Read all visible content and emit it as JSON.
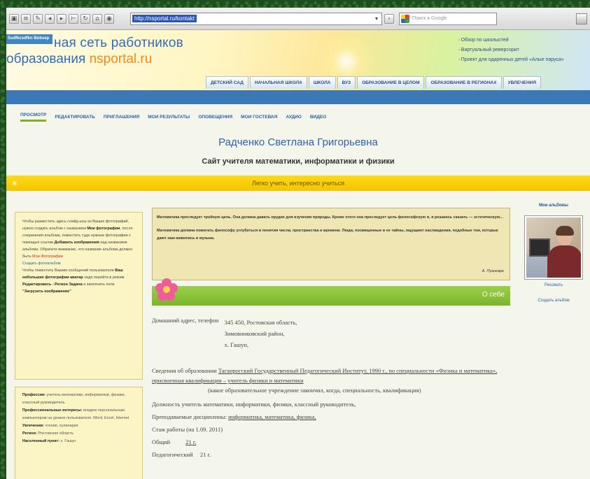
{
  "browser": {
    "url": "http://nsportal.ru/kontakt",
    "search_placeholder": "Поиск в Google"
  },
  "header": {
    "ribbon": "Ssdfkcsdfkn Bobsep",
    "site_name": "ная сеть работников",
    "site_sub_prefix": "образования ",
    "site_sub_brand": "nsportal.ru",
    "links": [
      "Обзор по школыстей",
      "Виртуальный реверсорит",
      "Проект для одаренных детей «Алые паруса»"
    ],
    "nav": [
      "ДЕТСКИЙ САД",
      "НАЧАЛЬНАЯ ШКОЛА",
      "ШКОЛА",
      "ВУЗ",
      "ОБРАЗОВАНИЕ В ЦЕЛОМ",
      "ОБРАЗОВАНИЕ В РЕГИОНАХ",
      "УВЛЕЧЕНИЯ"
    ]
  },
  "tabs": [
    "ПРОСМОТР",
    "РЕДАКТИРОВАТЬ",
    "ПРИГЛАШЕНИЯ",
    "МОИ РЕЗУЛЬТАТЫ",
    "ОПОВЕЩЕНИЯ",
    "МОИ ГОСТЕВАЯ",
    "АУДИО",
    "ВИДЕО"
  ],
  "page": {
    "title": "Радченко Светлана Григорьевна",
    "subtitle": "Сайт учителя математики, информатики и физики",
    "motto": "Легко учить, интересно учиться"
  },
  "left": {
    "box1": {
      "t1": "Чтобы разместить здесь слайд-шоу из Ваших фотографий, нужно создать альбом с названием",
      "b1": "Мои фотографии",
      "t2": ", после сохранения альбома, поместить туда нужные фотографии с помощью ссылки",
      "b2": "Добавить изображения",
      "t3": "над названием альбома. Обратите внимание, что название альбома должно быть",
      "r1": "Мои Фотографии",
      "l1": "Создать фотоальбом",
      "t4": "Чтобы поместить Вашим сообщений пользователи",
      "b3": "Ваш небольшие фотографии аватар",
      "t5": "надо перейти в режим",
      "b4": "Редактировать - Регион Задача",
      "t6": "и заполнить поле",
      "b5": "\"Загрузить изображение\""
    },
    "box2": {
      "rows": [
        {
          "k": "Профессия:",
          "v": "учитель математики, информатики, физики, классный руководитель"
        },
        {
          "k": "Профессиональные интересы:",
          "v": "владею персональным компьютером на уровне пользователя. Word, Excel, Internet"
        },
        {
          "k": "Увлечения:",
          "v": "чтение, кулинария"
        },
        {
          "k": "Регион:",
          "v": "Ростовская область"
        },
        {
          "k": "Населенный пункт:",
          "v": "х. Гашун"
        }
      ]
    }
  },
  "quote": {
    "p1": "Математика преследует тройную цель. Она должна давать орудие для изучения природы. Кроме этого она преследует цель философскую и, я решаюсь сказать — эстетическую...",
    "p2": "Математика должна помогать философу углубиться в понятия числа, пространства и времени. Люди, посвященные в ее тайны, ощущают наслаждения, подобные тем, которые дают нам живопись и музыка.",
    "author": "А. Пуанкаре"
  },
  "about_label": "О себе",
  "info": {
    "address_label": "Домашний адрес, телефон",
    "address_lines": [
      "345 450, Ростовская область,",
      "Зимовниковский район,",
      "х. Гашун,"
    ],
    "education_label": "Сведения об образовании",
    "education": "Таганрогский Государственный Педагогический Институт, 1990 г., по специальности «Физика и математика», присвоенная квалификация – учитель физики и математики",
    "education_note": "(какое образовательное учреждение закончил, когда, специальность, квалификация)",
    "position": "Должность    учитель математики, информатики, физики, классный руководитель,",
    "subjects_label": "Преподаваемые дисциплины:",
    "subjects": "информатика, математика, физика,",
    "experience_title": "Стаж работы (на 1.09. 2011)",
    "total_label": "Общий",
    "total_value": "21 г.",
    "ped_label": "Педагогический",
    "ped_value": "21 г."
  },
  "right": {
    "title": "Мои альбомы",
    "caption": "Рисовать",
    "create": "Создать альбом"
  },
  "colors": {
    "blue_bar": "#3b78b8",
    "yellow_bar": "#ffd915",
    "green_bar": "#7ab52a",
    "link": "#2a5fa5"
  }
}
